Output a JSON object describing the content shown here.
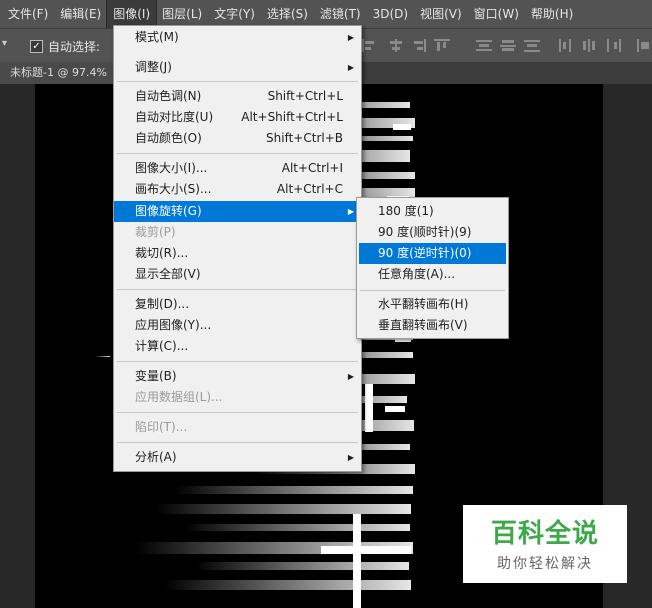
{
  "menubar": {
    "items": [
      {
        "label": "文件(F)"
      },
      {
        "label": "编辑(E)"
      },
      {
        "label": "图像(I)"
      },
      {
        "label": "图层(L)"
      },
      {
        "label": "文字(Y)"
      },
      {
        "label": "选择(S)"
      },
      {
        "label": "滤镜(T)"
      },
      {
        "label": "3D(D)"
      },
      {
        "label": "视图(V)"
      },
      {
        "label": "窗口(W)"
      },
      {
        "label": "帮助(H)"
      }
    ]
  },
  "options_bar": {
    "auto_select_label": "自动选择:",
    "auto_select_checked": "✓"
  },
  "document_tab": {
    "title": "未标题-1 @ 97.4%"
  },
  "image_menu": {
    "items": [
      {
        "label": "模式(M)",
        "shortcut": "",
        "submenu": "▶"
      },
      {
        "label": "调整(J)",
        "shortcut": "",
        "submenu": "▶"
      },
      {
        "label": "自动色调(N)",
        "shortcut": "Shift+Ctrl+L"
      },
      {
        "label": "自动对比度(U)",
        "shortcut": "Alt+Shift+Ctrl+L"
      },
      {
        "label": "自动颜色(O)",
        "shortcut": "Shift+Ctrl+B"
      },
      {
        "label": "图像大小(I)...",
        "shortcut": "Alt+Ctrl+I"
      },
      {
        "label": "画布大小(S)...",
        "shortcut": "Alt+Ctrl+C"
      },
      {
        "label": "图像旋转(G)",
        "shortcut": "",
        "submenu": "▶"
      },
      {
        "label": "裁剪(P)",
        "shortcut": ""
      },
      {
        "label": "裁切(R)...",
        "shortcut": ""
      },
      {
        "label": "显示全部(V)",
        "shortcut": ""
      },
      {
        "label": "复制(D)...",
        "shortcut": ""
      },
      {
        "label": "应用图像(Y)...",
        "shortcut": ""
      },
      {
        "label": "计算(C)...",
        "shortcut": ""
      },
      {
        "label": "变量(B)",
        "shortcut": "",
        "submenu": "▶"
      },
      {
        "label": "应用数据组(L)...",
        "shortcut": ""
      },
      {
        "label": "陷印(T)...",
        "shortcut": ""
      },
      {
        "label": "分析(A)",
        "shortcut": "",
        "submenu": "▶"
      }
    ]
  },
  "rotation_submenu": {
    "items": [
      {
        "label": "180 度(1)"
      },
      {
        "label": "90 度(顺时针)(9)"
      },
      {
        "label": "90 度(逆时针)(0)"
      },
      {
        "label": "任意角度(A)..."
      },
      {
        "label": "水平翻转画布(H)"
      },
      {
        "label": "垂直翻转画布(V)"
      }
    ]
  },
  "watermark": {
    "title": "百科全说",
    "subtitle": "助你轻松解决"
  },
  "colors": {
    "menubar": "#535353",
    "highlight": "#0078d7",
    "watermark_green": "#3fa94a",
    "canvas": "#000000"
  }
}
